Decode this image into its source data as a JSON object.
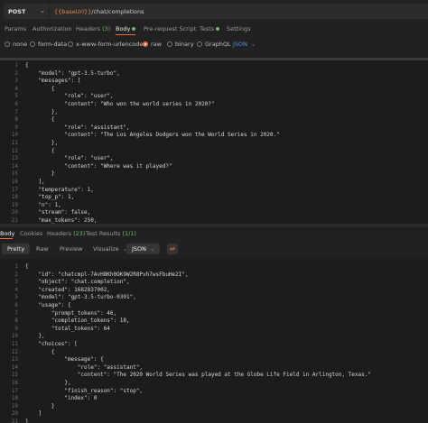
{
  "request": {
    "method": "POST",
    "url_var": "{{baseUrl}}",
    "url_path": "/chat/completions"
  },
  "req_tabs": [
    {
      "label": "Params"
    },
    {
      "label": "Authorization"
    },
    {
      "label": "Headers",
      "count": "(3)"
    },
    {
      "label": "Body",
      "active": true,
      "dot": true
    },
    {
      "label": "Pre-request Script"
    },
    {
      "label": "Tests",
      "dot": true
    },
    {
      "label": "Settings"
    }
  ],
  "body_types": [
    {
      "label": "none"
    },
    {
      "label": "form-data"
    },
    {
      "label": "x-www-form-urlencoded"
    },
    {
      "label": "raw",
      "selected": true
    },
    {
      "label": "binary"
    },
    {
      "label": "GraphQL"
    }
  ],
  "body_format": "JSON",
  "request_body_lines": [
    {
      "n": "1",
      "text": "{"
    },
    {
      "n": "2",
      "text": "    \"model\": \"gpt-3.5-turbo\","
    },
    {
      "n": "3",
      "text": "    \"messages\": ["
    },
    {
      "n": "4",
      "text": "        {"
    },
    {
      "n": "5",
      "text": "            \"role\": \"user\","
    },
    {
      "n": "6",
      "text": "            \"content\": \"Who won the world series in 2020?\""
    },
    {
      "n": "7",
      "text": "        },"
    },
    {
      "n": "8",
      "text": "        {"
    },
    {
      "n": "9",
      "text": "            \"role\": \"assistant\","
    },
    {
      "n": "10",
      "text": "            \"content\": \"The Los Angeles Dodgers won the World Series in 2020.\""
    },
    {
      "n": "11",
      "text": "        },"
    },
    {
      "n": "12",
      "text": "        {"
    },
    {
      "n": "13",
      "text": "            \"role\": \"user\","
    },
    {
      "n": "14",
      "text": "            \"content\": \"Where was it played?\""
    },
    {
      "n": "15",
      "text": "        }"
    },
    {
      "n": "16",
      "text": "    ],"
    },
    {
      "n": "17",
      "text": "    \"temperature\": 1,"
    },
    {
      "n": "18",
      "text": "    \"top_p\": 1,"
    },
    {
      "n": "19",
      "text": "    \"n\": 1,"
    },
    {
      "n": "20",
      "text": "    \"stream\": false,"
    },
    {
      "n": "21",
      "text": "    \"max_tokens\": 250,"
    }
  ],
  "resp_tabs": [
    {
      "label": "Body",
      "active": true
    },
    {
      "label": "Cookies"
    },
    {
      "label": "Headers",
      "count": "(23)"
    },
    {
      "label": "Test Results",
      "count": "(1/1)"
    }
  ],
  "resp_modes": [
    "Pretty",
    "Raw",
    "Preview",
    "Visualize"
  ],
  "resp_format": "JSON",
  "response_body_lines": [
    {
      "n": "1",
      "text": "{"
    },
    {
      "n": "2",
      "text": "    \"id\": \"chatcmpl-7AvH8Kh0OK9W2R8Pvh7wsFbuHe2I\","
    },
    {
      "n": "3",
      "text": "    \"object\": \"chat.completion\","
    },
    {
      "n": "4",
      "text": "    \"created\": 1682837002,"
    },
    {
      "n": "5",
      "text": "    \"model\": \"gpt-3.5-turbo-0301\","
    },
    {
      "n": "6",
      "text": "    \"usage\": {"
    },
    {
      "n": "7",
      "text": "        \"prompt_tokens\": 46,"
    },
    {
      "n": "8",
      "text": "        \"completion_tokens\": 18,"
    },
    {
      "n": "9",
      "text": "        \"total_tokens\": 64"
    },
    {
      "n": "10",
      "text": "    },"
    },
    {
      "n": "11",
      "text": "    \"choices\": ["
    },
    {
      "n": "12",
      "text": "        {"
    },
    {
      "n": "13",
      "text": "            \"message\": {"
    },
    {
      "n": "14",
      "text": "                \"role\": \"assistant\","
    },
    {
      "n": "15",
      "text": "                \"content\": \"The 2020 World Series was played at the Globe Life Field in Arlington, Texas.\""
    },
    {
      "n": "16",
      "text": "            },"
    },
    {
      "n": "17",
      "text": "            \"finish_reason\": \"stop\","
    },
    {
      "n": "18",
      "text": "            \"index\": 0"
    },
    {
      "n": "19",
      "text": "        }"
    },
    {
      "n": "20",
      "text": "    ]"
    },
    {
      "n": "21",
      "text": "}"
    }
  ],
  "icons": {
    "method_dropdown": "chevron-down-icon",
    "format_dropdown": "chevron-down-icon",
    "wrap": "wrap-lines-icon"
  },
  "colors": {
    "accent": "#f26b3a",
    "variable": "#e5874a",
    "dot": "#6fb86f",
    "json_link": "#4f8fe0"
  }
}
